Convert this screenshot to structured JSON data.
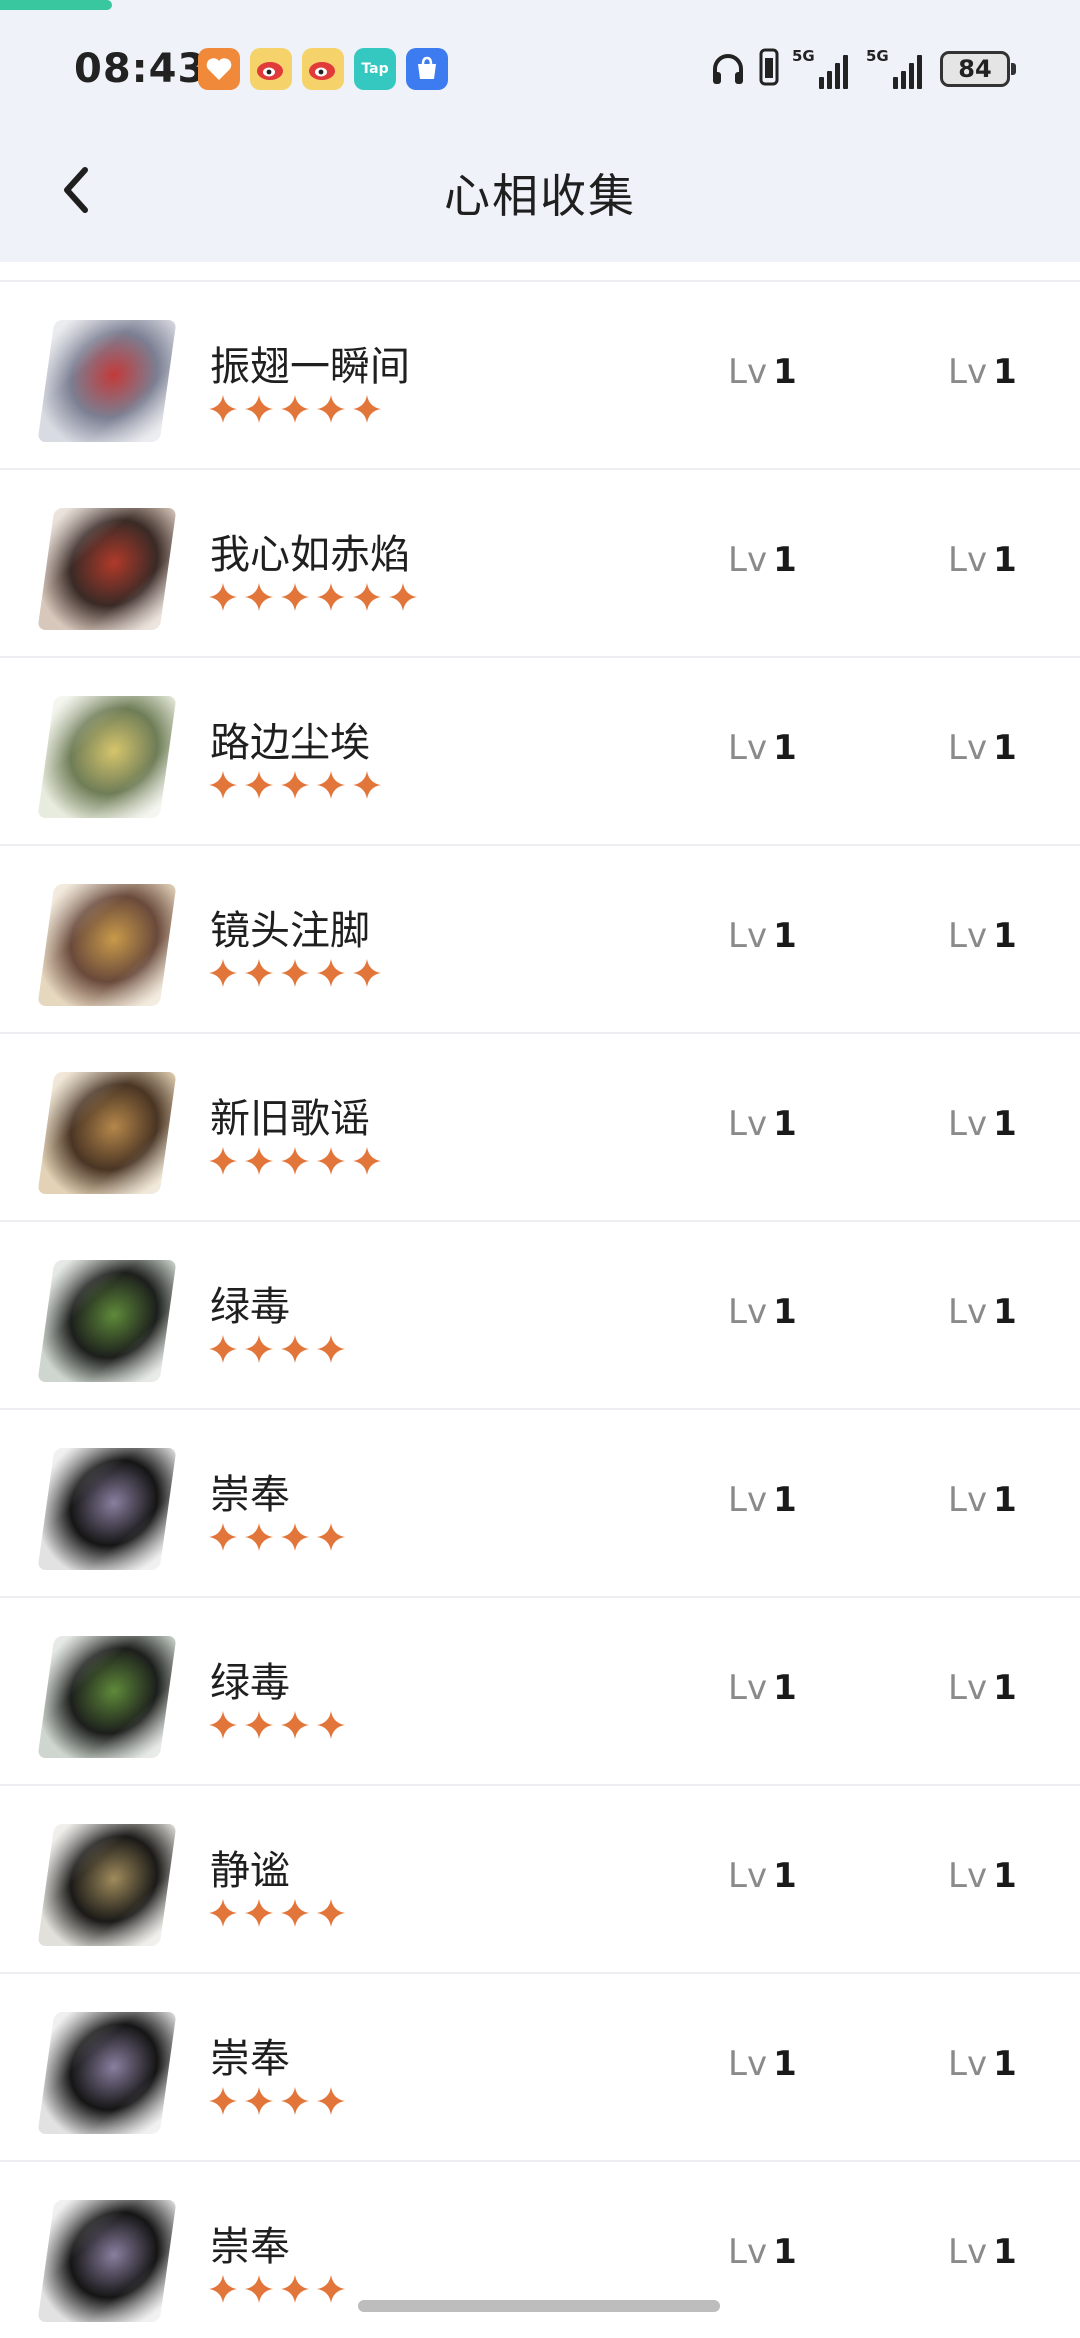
{
  "status_bar": {
    "time": "08:43",
    "app_icons": [
      "heart-app-icon",
      "weibo-icon",
      "weibo-icon",
      "tap-icon",
      "app-market-icon"
    ],
    "tap_label": "Tap",
    "market_label": "App Market",
    "signal_1_label": "5G",
    "signal_2_label": "5G",
    "battery": "84"
  },
  "nav": {
    "title": "心相收集"
  },
  "colors": {
    "star": "#e2763a",
    "header_bg": "#eff3f9",
    "progress": "#38c79e"
  },
  "list": {
    "lv_label": "Lv",
    "items": [
      {
        "name": "振翅一瞬间",
        "stars": 5,
        "lv1": "1",
        "lv2": "1",
        "art": [
          "#7b7f92",
          "#c23a3a",
          "#d9dbe3"
        ]
      },
      {
        "name": "我心如赤焰",
        "stars": 6,
        "lv1": "1",
        "lv2": "1",
        "art": [
          "#3a2a26",
          "#b03a2a",
          "#d8c7bb"
        ]
      },
      {
        "name": "路边尘埃",
        "stars": 5,
        "lv1": "1",
        "lv2": "1",
        "art": [
          "#6f7d57",
          "#d6c56c",
          "#e8ecde"
        ]
      },
      {
        "name": "镜头注脚",
        "stars": 5,
        "lv1": "1",
        "lv2": "1",
        "art": [
          "#6a4a3b",
          "#c99a4a",
          "#e6d7bf"
        ]
      },
      {
        "name": "新旧歌谣",
        "stars": 5,
        "lv1": "1",
        "lv2": "1",
        "art": [
          "#4a3524",
          "#b5874a",
          "#e3d2b5"
        ]
      },
      {
        "name": "绿毒",
        "stars": 4,
        "lv1": "1",
        "lv2": "1",
        "art": [
          "#1c1f1c",
          "#5f8a3a",
          "#cfd6cf"
        ]
      },
      {
        "name": "崇奉",
        "stars": 4,
        "lv1": "1",
        "lv2": "1",
        "art": [
          "#151515",
          "#8a7fa0",
          "#e2e2e2"
        ]
      },
      {
        "name": "绿毒",
        "stars": 4,
        "lv1": "1",
        "lv2": "1",
        "art": [
          "#1c1f1c",
          "#5f8a3a",
          "#cfd6cf"
        ]
      },
      {
        "name": "静谧",
        "stars": 4,
        "lv1": "1",
        "lv2": "1",
        "art": [
          "#1b1a18",
          "#a08c5c",
          "#e2e0da"
        ]
      },
      {
        "name": "崇奉",
        "stars": 4,
        "lv1": "1",
        "lv2": "1",
        "art": [
          "#151515",
          "#8a7fa0",
          "#e2e2e2"
        ]
      },
      {
        "name": "崇奉",
        "stars": 4,
        "lv1": "1",
        "lv2": "1",
        "art": [
          "#151515",
          "#8a7fa0",
          "#e2e2e2"
        ]
      }
    ]
  }
}
